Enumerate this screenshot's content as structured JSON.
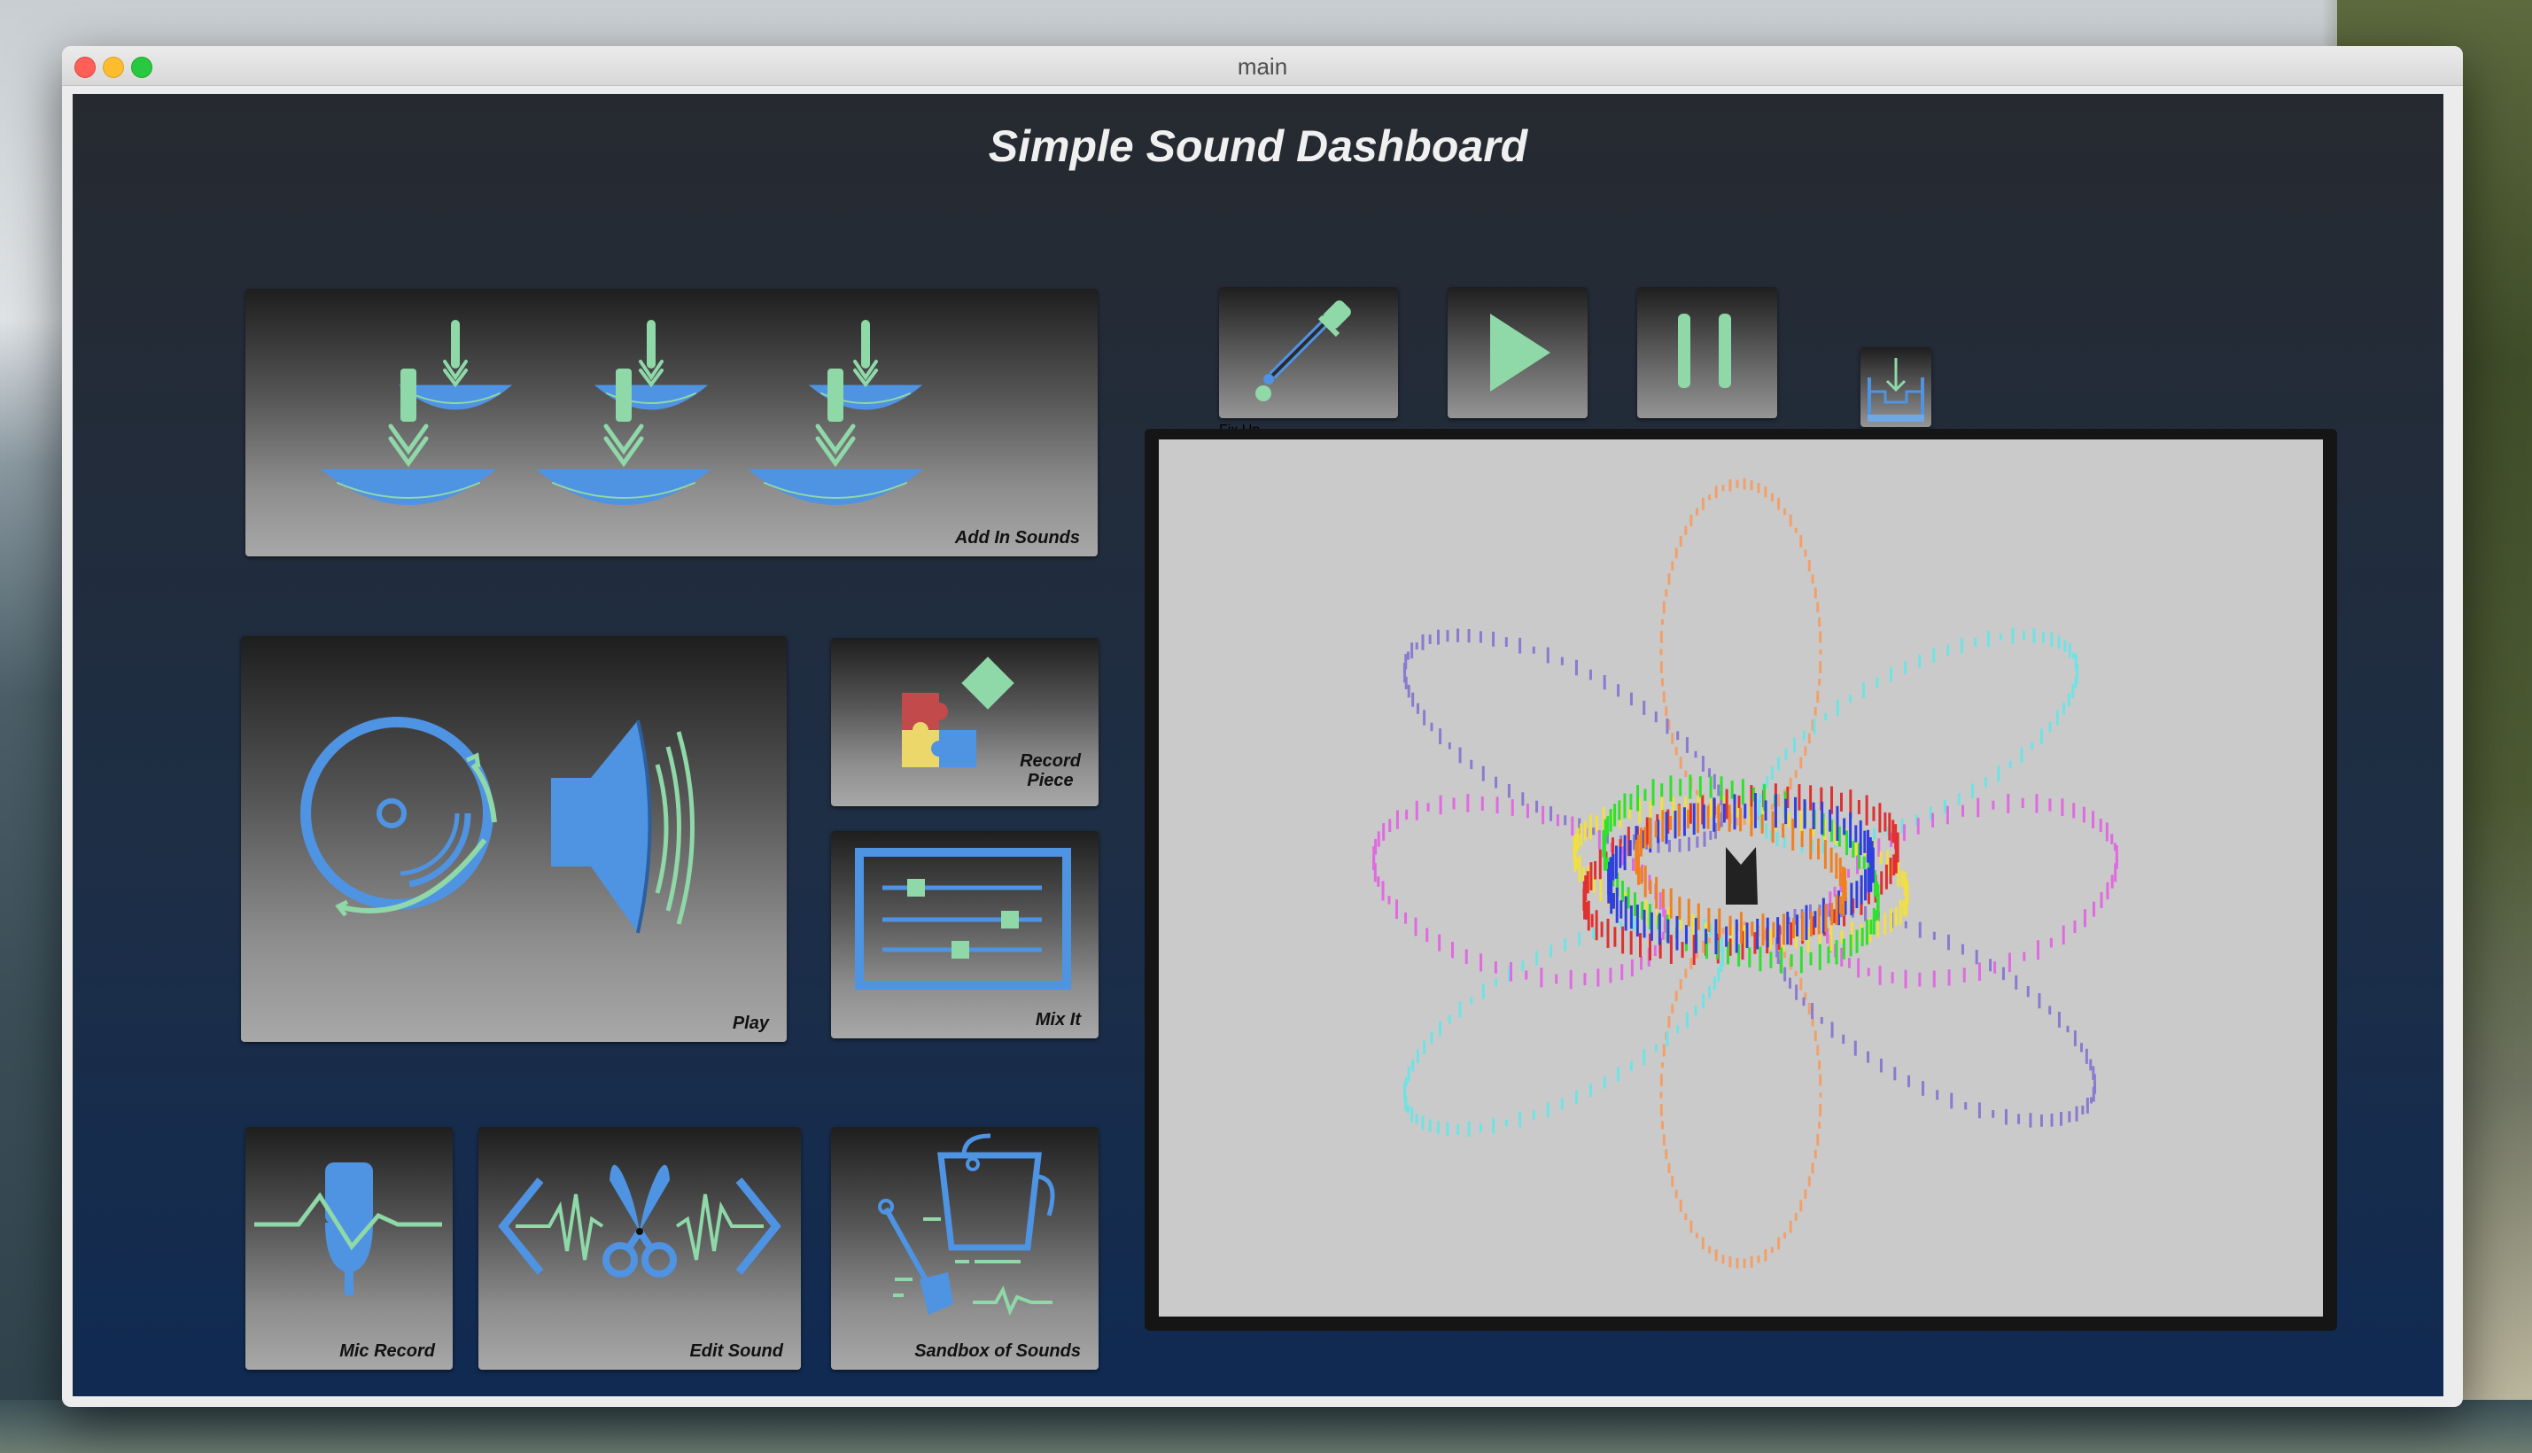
{
  "window": {
    "title": "main"
  },
  "app": {
    "title": "Simple Sound Dashboard",
    "tiles": {
      "add_sounds": "Add In Sounds",
      "play": "Play",
      "record_piece_line1": "Record",
      "record_piece_line2": "Piece",
      "mix": "Mix It",
      "mic_record": "Mic Record",
      "edit_sound": "Edit Sound",
      "sandbox": "Sandbox of Sounds"
    },
    "controls": {
      "fix_up": "Fix Up"
    }
  },
  "colors": {
    "accent_blue": "#4f93e3",
    "accent_green": "#8fd8a8",
    "app_bg_top": "#262a30",
    "app_bg_bottom": "#102a52"
  },
  "icons": [
    "import-bowls-icon",
    "vinyl-disc-icon",
    "speaker-icon",
    "puzzle-icon",
    "mixer-sliders-icon",
    "microphone-wave-icon",
    "scissors-waveform-icon",
    "sandbox-bucket-icon",
    "eyedropper-icon",
    "play-icon",
    "pause-icon",
    "save-download-icon"
  ]
}
